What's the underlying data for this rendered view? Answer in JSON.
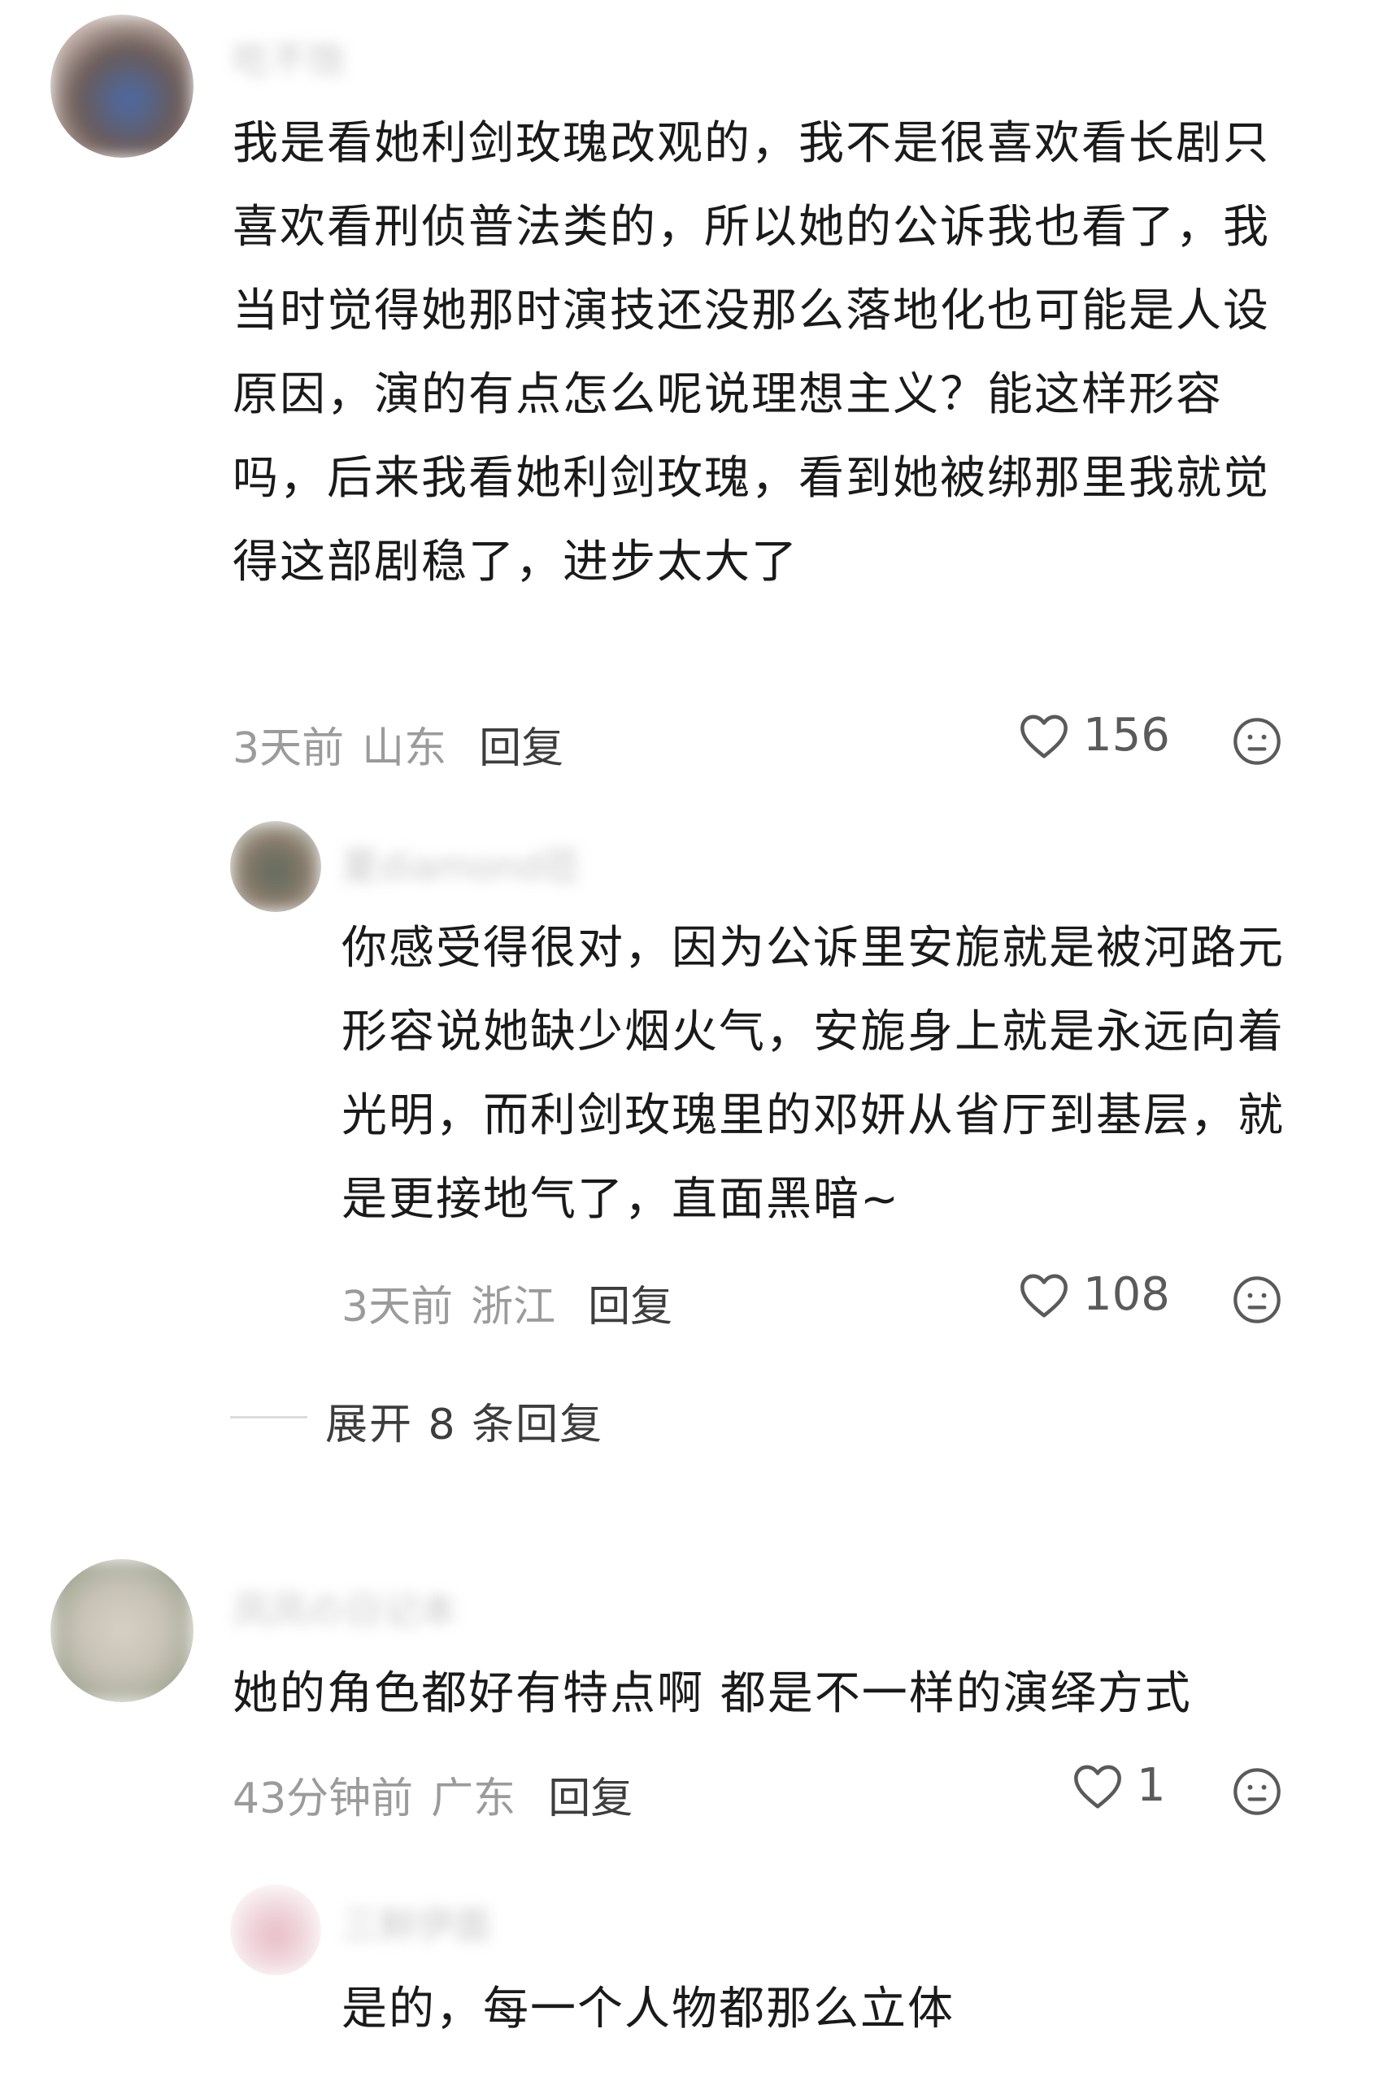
{
  "comments": [
    {
      "username": "吃不饱",
      "text": "我是看她利剑玫瑰改观的，我不是很喜欢看长剧只喜欢看刑侦普法类的，所以她的公诉我也看了，我当时觉得她那时演技还没那么落地化也可能是人设原因，演的有点怎么呢说理想主义？能这样形容吗，后来我看她利剑玫瑰，看到她被绑那里我就觉得这部剧稳了，进步太大了",
      "time": "3天前",
      "location": "山东",
      "reply_label": "回复",
      "likes": "156",
      "avatar_color": "#6b5a55",
      "replies": [
        {
          "username": "夏diamond莅",
          "text": "你感受得很对，因为公诉里安旎就是被河路元形容说她缺少烟火气，安旎身上就是永远向着光明，而利剑玫瑰里的邓妍从省厅到基层，就是更接地气了，直面黑暗~",
          "time": "3天前",
          "location": "浙江",
          "reply_label": "回复",
          "likes": "108",
          "avatar_color": "#5d6a5e"
        }
      ],
      "expand_label": "展开 8 条回复"
    },
    {
      "username": "凤凤の日记本",
      "text": "她的角色都好有特点啊 都是不一样的演绎方式",
      "time": "43分钟前",
      "location": "广东",
      "reply_label": "回复",
      "likes": "1",
      "avatar_color": "#c7c2b6",
      "replies": [
        {
          "username": "三鲜伊面",
          "text": "是的，每一个人物都那么立体",
          "avatar_color": "#e8b9c4"
        }
      ]
    }
  ],
  "icons": {
    "like": "heart-outline-icon",
    "react": "neutral-face-icon"
  }
}
